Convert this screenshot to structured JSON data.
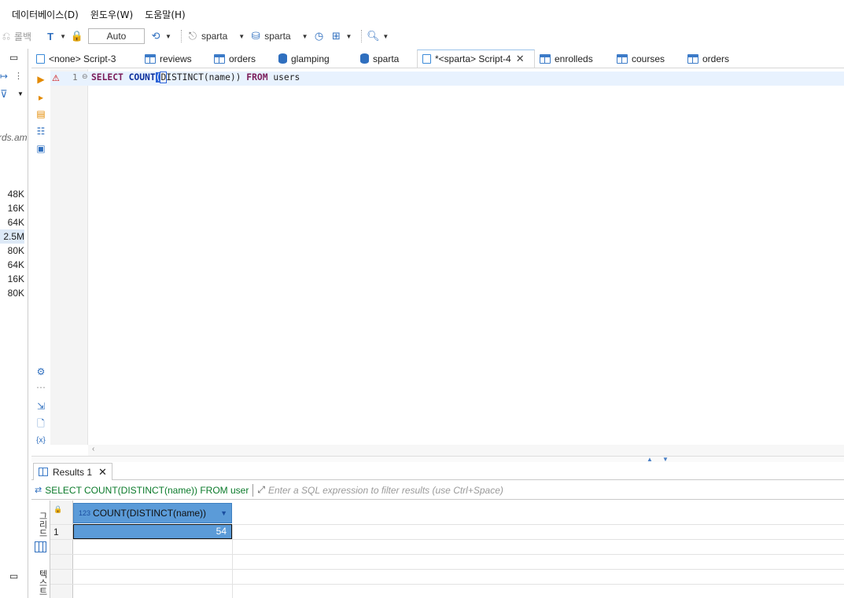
{
  "menu": {
    "items": [
      "데이터베이스(D)",
      "윈도우(W)",
      "도움말(H)"
    ]
  },
  "toolbar": {
    "rollback_label": "롤백",
    "transaction_mode": "Auto",
    "datasource_label": "sparta",
    "schema_label": "sparta"
  },
  "left_panel": {
    "clipped_text": "rds.am",
    "sizes": [
      "48K",
      "16K",
      "64K",
      "2.5M",
      "80K",
      "64K",
      "16K",
      "80K"
    ],
    "selected_index": 3
  },
  "editor_tabs": [
    {
      "label": "<none> Script-3",
      "icon": "script-icon",
      "active": false
    },
    {
      "label": "reviews",
      "icon": "table-icon",
      "active": false
    },
    {
      "label": "orders",
      "icon": "table-icon",
      "active": false
    },
    {
      "label": "glamping",
      "icon": "database-icon",
      "active": false
    },
    {
      "label": "sparta",
      "icon": "database-icon",
      "active": false
    },
    {
      "label": "*<sparta> Script-4",
      "icon": "script-icon",
      "active": true
    },
    {
      "label": "enrolleds",
      "icon": "table-icon",
      "active": false
    },
    {
      "label": "courses",
      "icon": "table-icon",
      "active": false
    },
    {
      "label": "orders",
      "icon": "table-icon",
      "active": false
    }
  ],
  "editor": {
    "line_number": "1",
    "code_parts": {
      "select": "SELECT",
      "count": "COUNT",
      "paren_open": "(",
      "distinct_d": "D",
      "distinct_rest": "ISTINCT",
      "args": "(name))",
      "from": "FROM",
      "table": "users"
    }
  },
  "results": {
    "tab_label": "Results 1",
    "query_text": "SELECT COUNT(DISTINCT(name)) FROM user",
    "filter_placeholder": "Enter a SQL expression to filter results (use Ctrl+Space)",
    "view_tabs": [
      "그리드",
      "텍스트"
    ],
    "columns": [
      {
        "type_label": "123",
        "name": "COUNT(DISTINCT(name))"
      }
    ],
    "rows": [
      {
        "row_number": "1",
        "values": [
          "54"
        ]
      }
    ]
  },
  "colors": {
    "accent": "#5b9bd8",
    "filter_query": "#0a7a2a",
    "keyword": "#7b1d5a"
  }
}
